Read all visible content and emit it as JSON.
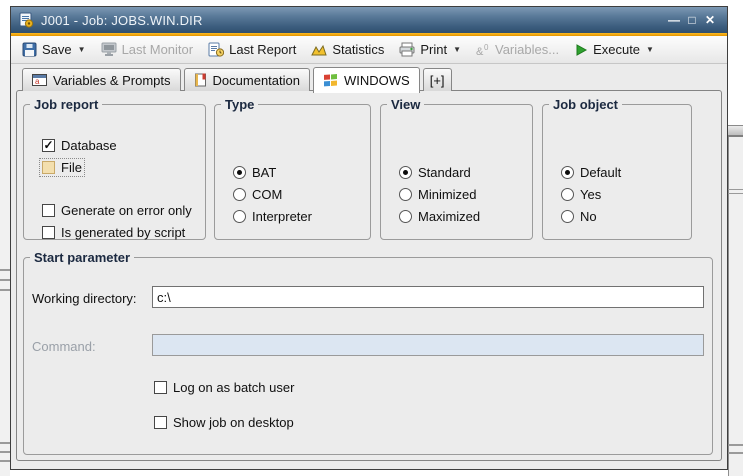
{
  "window": {
    "title": "J001 - Job: JOBS.WIN.DIR",
    "controls": {
      "minimize": "—",
      "maximize": "□",
      "close": "✕"
    }
  },
  "toolbar": {
    "save": "Save",
    "last_monitor": "Last Monitor",
    "last_report": "Last Report",
    "statistics": "Statistics",
    "print": "Print",
    "variables": "Variables...",
    "execute": "Execute"
  },
  "tabs": [
    {
      "label": "Variables & Prompts",
      "icon": "prompt-window-icon",
      "active": false
    },
    {
      "label": "Documentation",
      "icon": "notebook-icon",
      "active": false
    },
    {
      "label": "WINDOWS",
      "icon": "windows-logo-icon",
      "active": true
    },
    {
      "label": "[+]",
      "icon": "none",
      "active": false
    }
  ],
  "groups": {
    "job_report": {
      "title": "Job report",
      "checkboxes": [
        {
          "label": "Database",
          "checked": true
        },
        {
          "label": "File",
          "checked": false,
          "focused": true
        },
        {
          "label": "Generate on error only",
          "checked": false
        },
        {
          "label": "Is generated by script",
          "checked": false
        }
      ]
    },
    "type": {
      "title": "Type",
      "options": [
        {
          "label": "BAT",
          "selected": true
        },
        {
          "label": "COM",
          "selected": false
        },
        {
          "label": "Interpreter",
          "selected": false
        }
      ]
    },
    "view": {
      "title": "View",
      "options": [
        {
          "label": "Standard",
          "selected": true
        },
        {
          "label": "Minimized",
          "selected": false
        },
        {
          "label": "Maximized",
          "selected": false
        }
      ]
    },
    "job_object": {
      "title": "Job object",
      "options": [
        {
          "label": "Default",
          "selected": true
        },
        {
          "label": "Yes",
          "selected": false
        },
        {
          "label": "No",
          "selected": false
        }
      ]
    },
    "start_parameter": {
      "title": "Start parameter",
      "working_directory_label": "Working directory:",
      "working_directory_value": "c:\\",
      "command_label": "Command:",
      "command_value": "",
      "checkboxes": [
        {
          "label": "Log on as batch user",
          "checked": false
        },
        {
          "label": "Show job on desktop",
          "checked": false
        }
      ]
    }
  },
  "colors": {
    "titlebar_top": "#7d99b4",
    "titlebar_bottom": "#30506f",
    "accent_orange": "#efa50a",
    "disabled_field_bg": "#dce6f2",
    "focused_checkbox_fill": "#f3dfae",
    "panel_bg": "#ececec"
  }
}
